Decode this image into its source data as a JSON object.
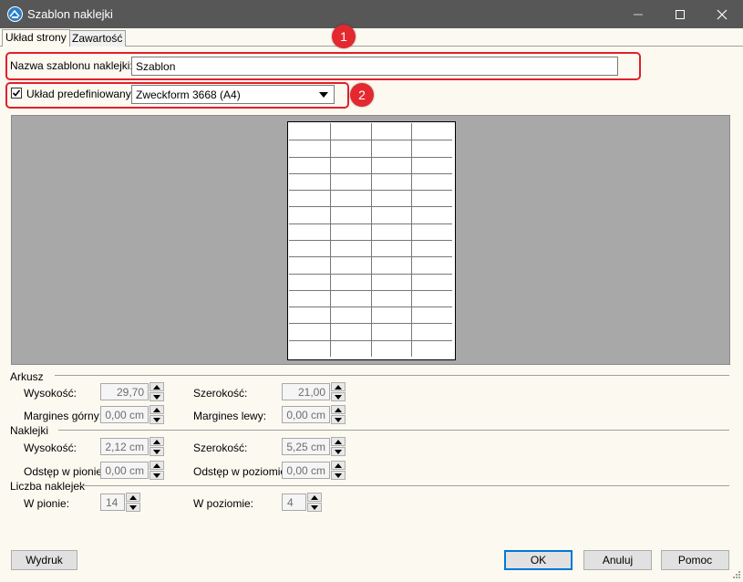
{
  "window": {
    "title": "Szablon naklejki"
  },
  "tabs": [
    {
      "label": "Układ strony",
      "active": true
    },
    {
      "label": "Zawartość",
      "active": false
    }
  ],
  "badges": [
    "1",
    "2"
  ],
  "template_name": {
    "label": "Nazwa szablonu naklejki:",
    "value": "Szablon"
  },
  "predefined": {
    "label": "Układ predefiniowany",
    "checked": true,
    "selected": "Zweckform 3668 (A4)"
  },
  "sheet": {
    "section": "Arkusz",
    "height_label": "Wysokość:",
    "height_value": "29,70 cm",
    "width_label": "Szerokość:",
    "width_value": "21,00 cm",
    "top_margin_label": "Margines górny:",
    "top_margin_value": "0,00 cm",
    "left_margin_label": "Margines lewy:",
    "left_margin_value": "0,00 cm"
  },
  "labels": {
    "section": "Naklejki",
    "height_label": "Wysokość:",
    "height_value": "2,12 cm",
    "width_label": "Szerokość:",
    "width_value": "5,25 cm",
    "vgap_label": "Odstęp w pionie:",
    "vgap_value": "0,00 cm",
    "hgap_label": "Odstęp w poziomie:",
    "hgap_value": "0,00 cm"
  },
  "count": {
    "section": "Liczba naklejek",
    "vertical_label": "W pionie:",
    "vertical_value": "14",
    "horizontal_label": "W poziomie:",
    "horizontal_value": "4"
  },
  "buttons": {
    "print": "Wydruk",
    "ok": "OK",
    "cancel": "Anuluj",
    "help": "Pomoc"
  },
  "colors": {
    "highlight": "#e0202a",
    "titlebar": "#575757",
    "preview_bg": "#a8a8a8"
  }
}
